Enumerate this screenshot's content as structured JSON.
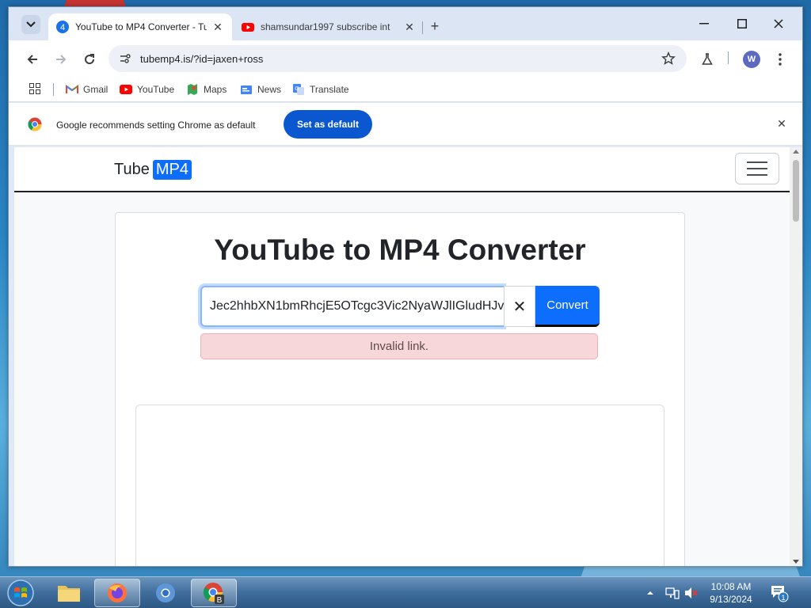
{
  "tabs": [
    {
      "title": "YouTube to MP4 Converter - Tu",
      "badge": "4",
      "active": true
    },
    {
      "title": "shamsundar1997 subscribe int",
      "active": false
    }
  ],
  "toolbar": {
    "url": "tubemp4.is/?id=jaxen+ross"
  },
  "bookmarks": [
    {
      "label": "Gmail",
      "icon": "gmail-icon"
    },
    {
      "label": "YouTube",
      "icon": "youtube-icon"
    },
    {
      "label": "Maps",
      "icon": "maps-icon"
    },
    {
      "label": "News",
      "icon": "news-icon"
    },
    {
      "label": "Translate",
      "icon": "translate-icon"
    }
  ],
  "infobar": {
    "message": "Google recommends setting Chrome as default",
    "button_label": "Set as default"
  },
  "site": {
    "brand_text": "Tube",
    "brand_badge": "MP4",
    "heading": "YouTube to MP4 Converter",
    "input_value": "Jec2hhbXN1bmRhcjE5OTcgc3Vic2NyaWJlIGludHJv",
    "convert_label": "Convert",
    "alert_text": "Invalid link.",
    "clear_symbol": "✕"
  },
  "profile": {
    "initial": "W"
  },
  "taskbar": {
    "time": "10:08 AM",
    "date": "9/13/2024",
    "notification_count": "1",
    "chrome_badge": "B"
  },
  "colors": {
    "accent": "#0d6efd",
    "chrome_blue": "#0b57d0",
    "alert_bg": "#f8d7da"
  }
}
